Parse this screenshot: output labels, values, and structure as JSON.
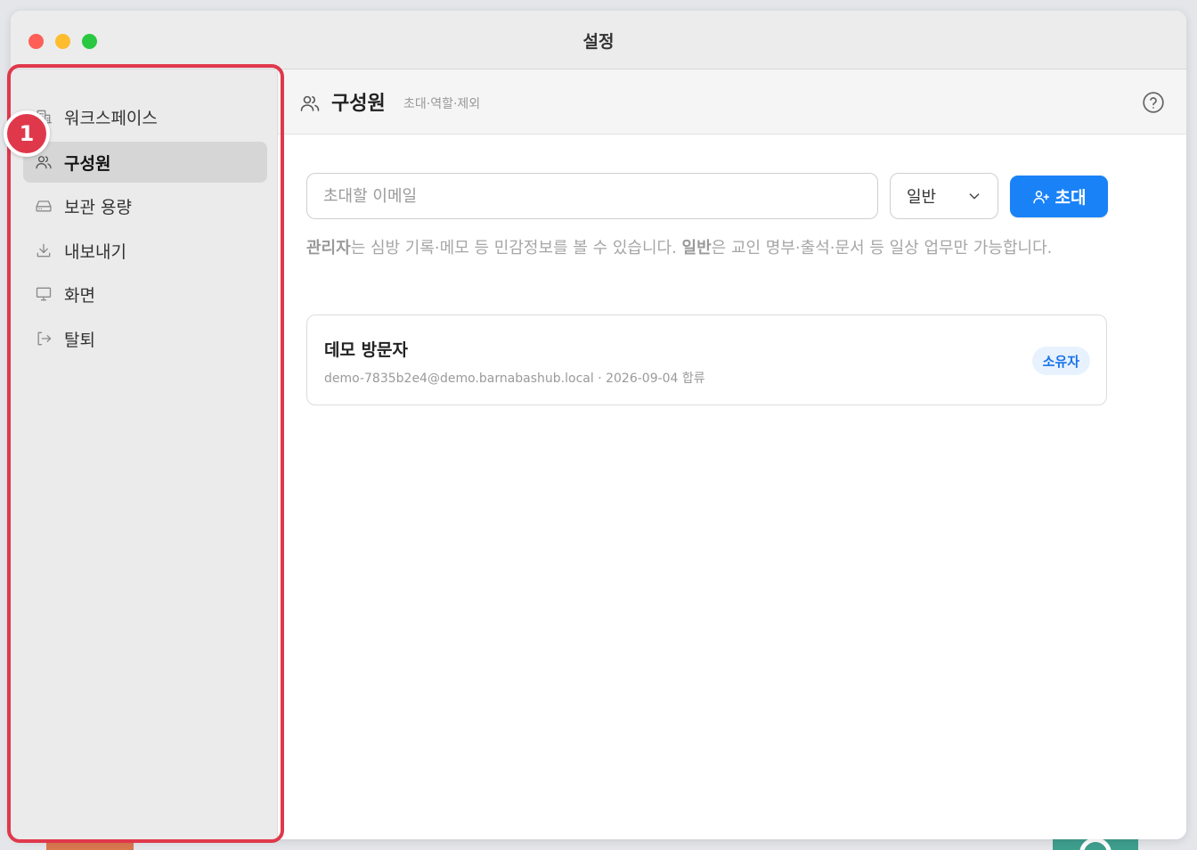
{
  "window": {
    "title": "설정"
  },
  "sidebar": {
    "items": [
      {
        "label": "워크스페이스",
        "icon": "building-icon",
        "active": false
      },
      {
        "label": "구성원",
        "icon": "users-icon",
        "active": true
      },
      {
        "label": "보관 용량",
        "icon": "hard-drive-icon",
        "active": false
      },
      {
        "label": "내보내기",
        "icon": "download-icon",
        "active": false
      },
      {
        "label": "화면",
        "icon": "monitor-icon",
        "active": false
      },
      {
        "label": "탈퇴",
        "icon": "logout-icon",
        "active": false
      }
    ]
  },
  "annotation": {
    "number": "1",
    "color": "#e0384b"
  },
  "header": {
    "title": "구성원",
    "subtitle": "초대·역할·제외",
    "icon": "users-icon",
    "help_icon": "question-circle-icon"
  },
  "invite": {
    "email_placeholder": "초대할 이메일",
    "email_value": "",
    "role_selected": "일반",
    "button_label": "초대",
    "button_icon": "user-plus-icon",
    "accent": "#1a82f7"
  },
  "role_help": {
    "admin_term": "관리자",
    "admin_desc": "는 심방 기록·메모 등 민감정보를 볼 수 있습니다. ",
    "normal_term": "일반",
    "normal_desc": "은 교인 명부·출석·문서 등 일상 업무만 가능합니다."
  },
  "members": [
    {
      "name": "데모 방문자",
      "meta": "demo-7835b2e4@demo.barnabashub.local · 2026-09-04 합류",
      "role_badge": "소유자"
    }
  ]
}
